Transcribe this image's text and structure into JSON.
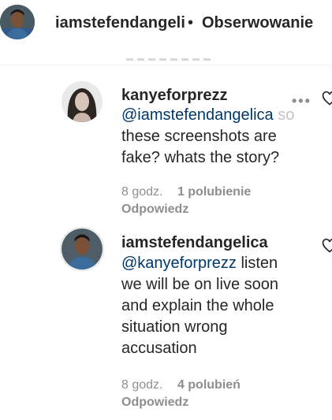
{
  "header": {
    "username": "iamstefendangeli",
    "separator": "•",
    "follow_status": "Obserwowanie"
  },
  "comments": [
    {
      "username": "kanyeforprezz",
      "mention": "@iamstefendangelica",
      "overflow_fragment": "so",
      "text": "these screenshots are fake? whats the story?",
      "more_label": "•••",
      "time": "8 godz.",
      "likes": "1 polubienie",
      "reply_label": "Odpowiedz"
    },
    {
      "username": "iamstefendangelica",
      "mention": "@kanyeforprezz",
      "text_first": "listen",
      "text_rest": "we will be on live soon and explain the whole situation wrong accusation",
      "time": "8 godz.",
      "likes": "4 polubień",
      "reply_label": "Odpowiedz"
    }
  ],
  "colors": {
    "text": "#262626",
    "secondary": "#8e8e8e",
    "mention": "#00376b",
    "divider": "#efefef"
  },
  "icons": {
    "more": "more-options-icon",
    "heart": "heart-outline-icon"
  }
}
